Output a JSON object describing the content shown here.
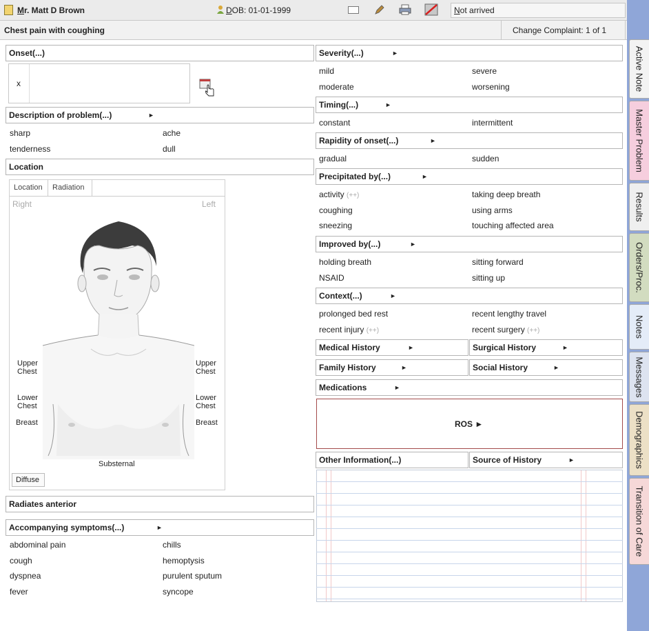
{
  "patient": {
    "name_prefix": "M",
    "name_rest": "r. Matt D Brown",
    "dob_prefix": "D",
    "dob_rest": "OB: 01-01-1999",
    "status_prefix": "N",
    "status_rest": "ot arrived"
  },
  "complaint": {
    "title": "Chest pain with coughing",
    "change_button": "Change Complaint: 1 of 1"
  },
  "left": {
    "onset": {
      "label": "Onset(...)",
      "value": "x"
    },
    "description": {
      "label": "Description of problem(...)",
      "items": [
        "sharp",
        "ache",
        "tenderness",
        "dull"
      ]
    },
    "location": {
      "label": "Location",
      "tabs": [
        "Location",
        "Radiation"
      ],
      "right_label": "Right",
      "left_label": "Left",
      "body_labels": {
        "upper_left": "Upper\nChest",
        "upper_right": "Upper\nChest",
        "lower_left": "Lower\nChest",
        "lower_right": "Lower\nChest",
        "breast_left": "Breast",
        "breast_right": "Breast",
        "substernal": "Substernal"
      },
      "diffuse_button": "Diffuse"
    },
    "radiates": {
      "label": "Radiates anterior"
    },
    "accompanying": {
      "label": "Accompanying symptoms(...)",
      "items": [
        "abdominal pain",
        "chills",
        "cough",
        "hemoptysis",
        "dyspnea",
        "purulent sputum",
        "fever",
        "syncope"
      ]
    }
  },
  "right": {
    "severity": {
      "label": "Severity(...)",
      "items": [
        "mild",
        "severe",
        "moderate",
        "worsening"
      ]
    },
    "timing": {
      "label": "Timing(...)",
      "items": [
        "constant",
        "intermittent"
      ]
    },
    "rapidity": {
      "label": "Rapidity of onset(...)",
      "items": [
        "gradual",
        "sudden"
      ]
    },
    "precipitated": {
      "label": "Precipitated by(...)",
      "items": [
        "activity",
        "taking deep breath",
        "coughing",
        "using arms",
        "sneezing",
        "touching affected area"
      ],
      "plus": "(++)"
    },
    "improved": {
      "label": "Improved by(...)",
      "items": [
        "holding breath",
        "sitting forward",
        "NSAID",
        "sitting up"
      ]
    },
    "context": {
      "label": "Context(...)",
      "items": [
        "prolonged bed rest",
        "recent lengthy travel",
        "recent injury",
        "recent surgery"
      ],
      "plus": "(++)"
    },
    "medical_history": "Medical History",
    "surgical_history": "Surgical History",
    "family_history": "Family History",
    "social_history": "Social History",
    "medications": "Medications",
    "ros": "ROS ►",
    "other_info": "Other Information(...)",
    "source_history": "Source of History"
  },
  "arrow": "►",
  "tabs": [
    "Active Note",
    "Master Problem",
    "Results",
    "Orders/Proc.",
    "Notes",
    "Messages",
    "Demographics",
    "Transition of Care"
  ],
  "colors": {
    "active_note": "#f3f3f3",
    "master_problem": "#f6cede",
    "results": "#efefef",
    "orders": "#d2dcc0",
    "notes": "#e4ecf8",
    "messages": "#dde3f0",
    "demographics": "#ece0c6",
    "transition": "#f6d8d8",
    "sidebar": "#8fa6d8"
  }
}
